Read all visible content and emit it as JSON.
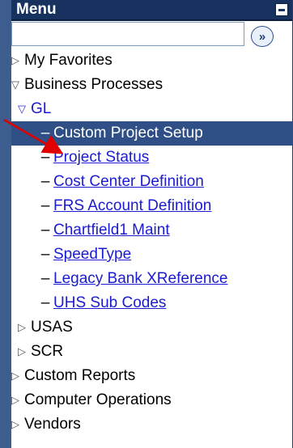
{
  "menu": {
    "title": "Menu",
    "search": {
      "value": "",
      "go_label": "»"
    },
    "items": [
      {
        "label": "My Favorites",
        "state": "collapsed"
      },
      {
        "label": "Business Processes",
        "state": "expanded"
      },
      {
        "label": "GL",
        "state": "expanded"
      },
      {
        "label": "Custom Project Setup",
        "selected": true
      },
      {
        "label": "Project Status"
      },
      {
        "label": "Cost Center Definition"
      },
      {
        "label": "FRS Account Definition"
      },
      {
        "label": "Chartfield1 Maint"
      },
      {
        "label": "SpeedType"
      },
      {
        "label": "Legacy Bank XReference"
      },
      {
        "label": "UHS Sub Codes"
      },
      {
        "label": "USAS",
        "state": "collapsed"
      },
      {
        "label": "SCR",
        "state": "collapsed"
      },
      {
        "label": "Custom Reports",
        "state": "collapsed"
      },
      {
        "label": "Computer Operations",
        "state": "collapsed"
      },
      {
        "label": "Vendors",
        "state": "collapsed"
      }
    ]
  },
  "colors": {
    "header_bg": "#17325e",
    "selected_bg": "#2f4f86",
    "link": "#1b1bd0",
    "annotation_arrow": "#e00000"
  }
}
